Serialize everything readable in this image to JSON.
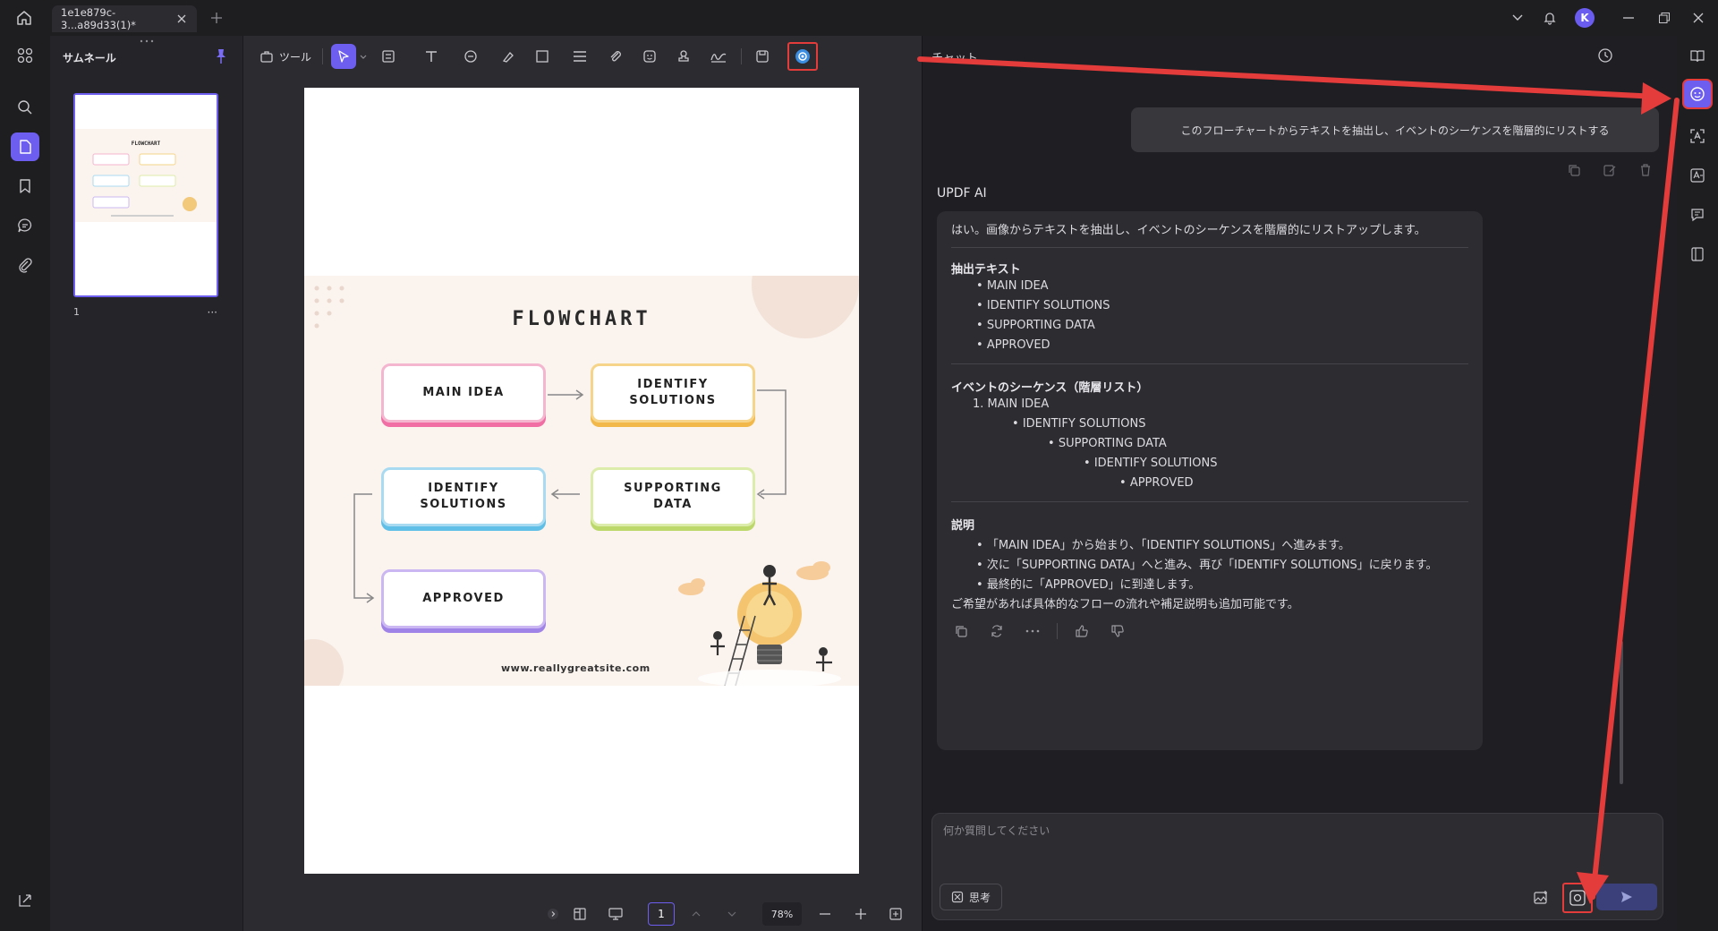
{
  "app": {
    "tab_title": "1e1e879c-3...a89d33(1)*",
    "user_initial": "K"
  },
  "thumbnails": {
    "title": "サムネール",
    "page_label": "1",
    "more": "···"
  },
  "toolbar": {
    "tools_label": "ツール"
  },
  "document": {
    "flow_title": "FLOWCHART",
    "boxes": {
      "main_idea": "MAIN IDEA",
      "identify_1": "IDENTIFY\nSOLUTIONS",
      "identify_2": "IDENTIFY\nSOLUTIONS",
      "supporting": "SUPPORTING\nDATA",
      "approved": "APPROVED"
    },
    "url": "www.reallygreatsite.com"
  },
  "bottombar": {
    "page_number": "1",
    "zoom": "78%"
  },
  "chat": {
    "title": "チャット",
    "user_message": "このフローチャートからテキストを抽出し、イベントのシーケンスを階層的にリストする",
    "ai_name": "UPDF AI",
    "intro": "はい。画像からテキストを抽出し、イベントのシーケンスを階層的にリストアップします。",
    "section1_title": "抽出テキスト",
    "extracted": [
      "MAIN IDEA",
      "IDENTIFY SOLUTIONS",
      "SUPPORTING DATA",
      "APPROVED"
    ],
    "section2_title": "イベントのシーケンス（階層リスト）",
    "sequence_root": "1. MAIN IDEA",
    "sequence_nested": [
      "IDENTIFY SOLUTIONS",
      "SUPPORTING DATA",
      "IDENTIFY SOLUTIONS",
      "APPROVED"
    ],
    "section3_title": "説明",
    "explanation": [
      "「MAIN IDEA」から始まり、「IDENTIFY SOLUTIONS」へ進みます。",
      "次に「SUPPORTING DATA」へと進み、再び「IDENTIFY SOLUTIONS」に戻ります。",
      "最終的に「APPROVED」に到達します。"
    ],
    "closing": "ご希望があれば具体的なフローの流れや補足説明も追加可能です。",
    "input_placeholder": "何か質問してください",
    "think_label": "思考"
  },
  "colors": {
    "accent": "#6d5ef0",
    "highlight": "#e43b3b"
  }
}
